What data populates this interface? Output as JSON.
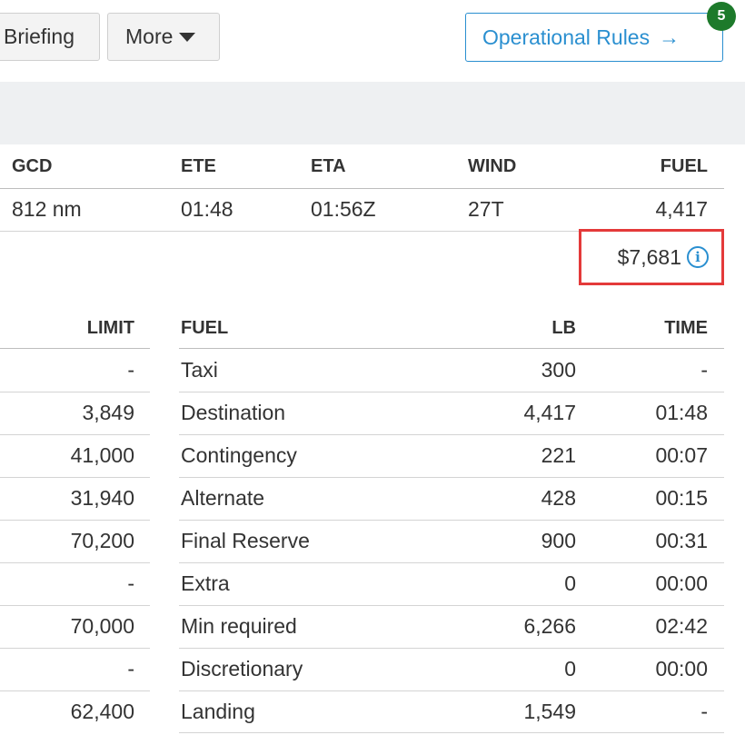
{
  "toolbar": {
    "briefing_label": "Briefing",
    "more_label": "More",
    "ops_label": "Operational Rules",
    "ops_arrow": "→",
    "badge_count": "5"
  },
  "summary": {
    "headers": {
      "gcd": "GCD",
      "ete": "ETE",
      "eta": "ETA",
      "wind": "WIND",
      "fuel": "FUEL"
    },
    "values": {
      "gcd": "812 nm",
      "ete": "01:48",
      "eta": "01:56Z",
      "wind": "27T",
      "fuel": "4,417"
    },
    "cost": "$7,681",
    "info_glyph": "i"
  },
  "limits": {
    "header": "LIMIT",
    "values": [
      "-",
      "3,849",
      "41,000",
      "31,940",
      "70,200",
      "-",
      "70,000",
      "-",
      "62,400"
    ]
  },
  "fuel_table": {
    "headers": {
      "fuel": "FUEL",
      "lb": "LB",
      "time": "TIME"
    },
    "rows": [
      {
        "name": "Taxi",
        "lb": "300",
        "time": "-"
      },
      {
        "name": "Destination",
        "lb": "4,417",
        "time": "01:48"
      },
      {
        "name": "Contingency",
        "lb": "221",
        "time": "00:07"
      },
      {
        "name": "Alternate",
        "lb": "428",
        "time": "00:15"
      },
      {
        "name": "Final Reserve",
        "lb": "900",
        "time": "00:31"
      },
      {
        "name": "Extra",
        "lb": "0",
        "time": "00:00"
      },
      {
        "name": "Min required",
        "lb": "6,266",
        "time": "02:42"
      },
      {
        "name": "Discretionary",
        "lb": "0",
        "time": "00:00"
      },
      {
        "name": "Landing",
        "lb": "1,549",
        "time": "-"
      }
    ]
  },
  "colors": {
    "accent": "#2a8fd0",
    "badge": "#1d7a2b",
    "highlight": "#e43a3a",
    "band": "#eef0f2"
  }
}
